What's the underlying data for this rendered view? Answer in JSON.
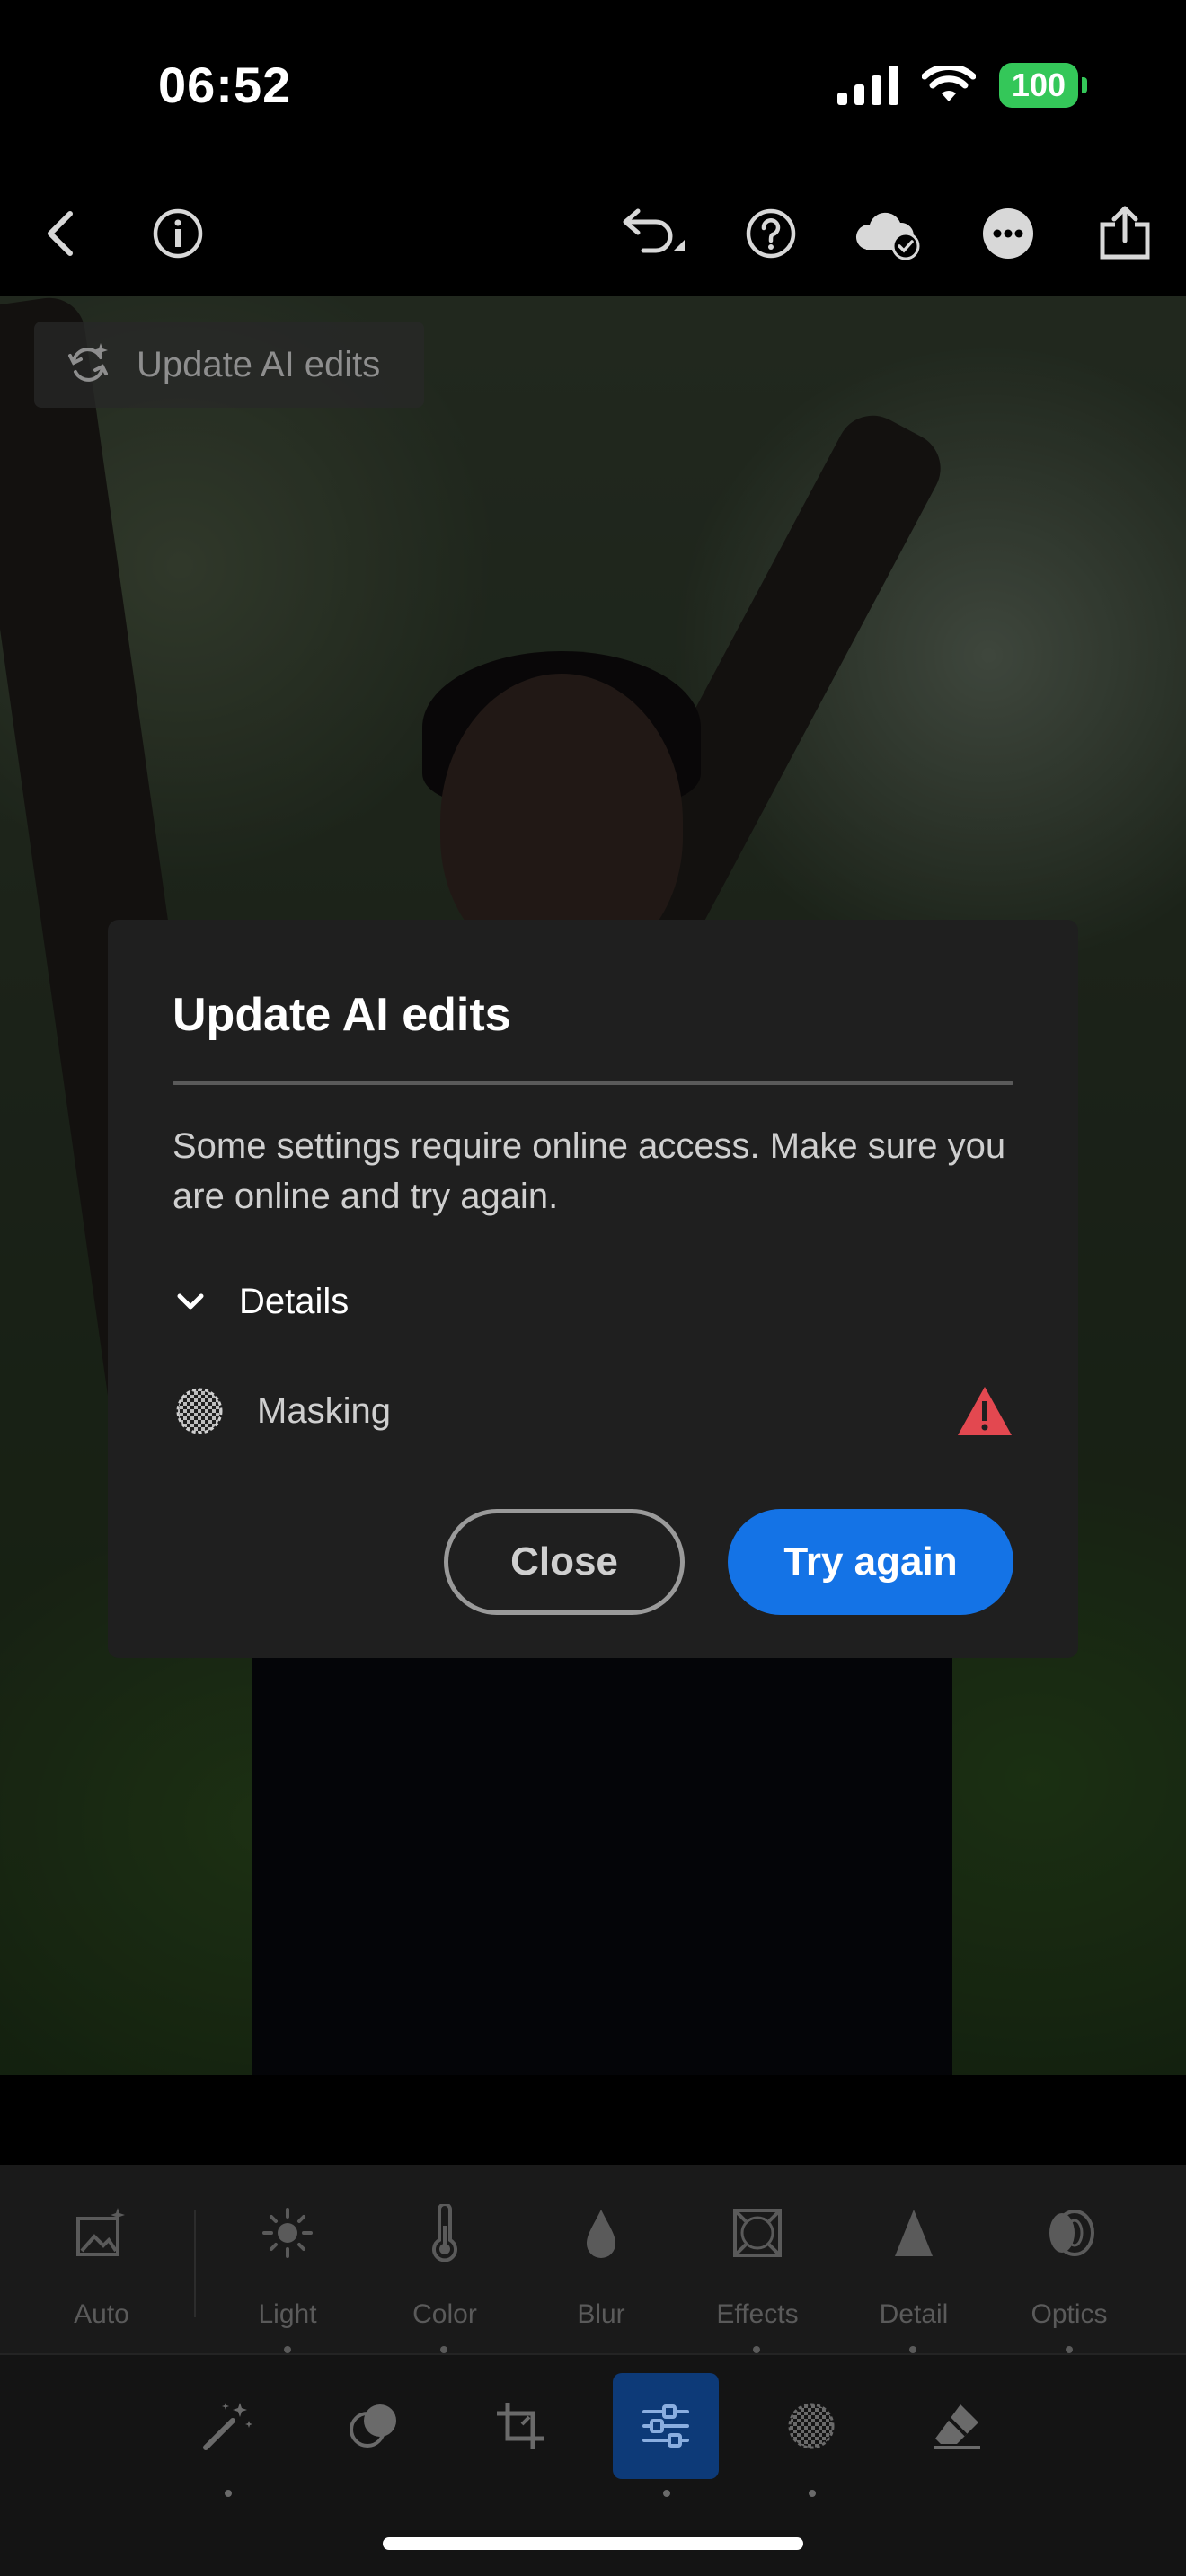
{
  "status_bar": {
    "time": "06:52",
    "battery": "100"
  },
  "top_toolbar": {
    "icons": [
      "back-chevron-icon",
      "info-icon",
      "undo-icon",
      "help-icon",
      "cloud-synced-icon",
      "more-icon",
      "share-icon"
    ]
  },
  "photo_overlay": {
    "update_ai_chip": "Update AI edits"
  },
  "dialog": {
    "title": "Update AI edits",
    "message": "Some settings require online access. Make sure you are online and try again.",
    "details_label": "Details",
    "items": [
      {
        "label": "Masking",
        "status": "warning"
      }
    ],
    "close_label": "Close",
    "try_again_label": "Try again",
    "accent_color": "#1473e6",
    "warning_color": "#e34850"
  },
  "edit_panel": {
    "items": [
      {
        "label": "Auto",
        "icon": "auto-photo-icon"
      },
      {
        "label": "Light",
        "icon": "sun-icon"
      },
      {
        "label": "Color",
        "icon": "thermometer-icon"
      },
      {
        "label": "Blur",
        "icon": "droplet-icon"
      },
      {
        "label": "Effects",
        "icon": "vignette-icon"
      },
      {
        "label": "Detail",
        "icon": "triangle-icon"
      },
      {
        "label": "Optics",
        "icon": "lens-icon"
      }
    ]
  },
  "bottom_tabs": {
    "items": [
      {
        "icon": "magic-wand-icon"
      },
      {
        "icon": "presets-icon"
      },
      {
        "icon": "crop-icon"
      },
      {
        "icon": "sliders-icon",
        "active": true
      },
      {
        "icon": "masking-icon"
      },
      {
        "icon": "eraser-icon"
      }
    ]
  }
}
